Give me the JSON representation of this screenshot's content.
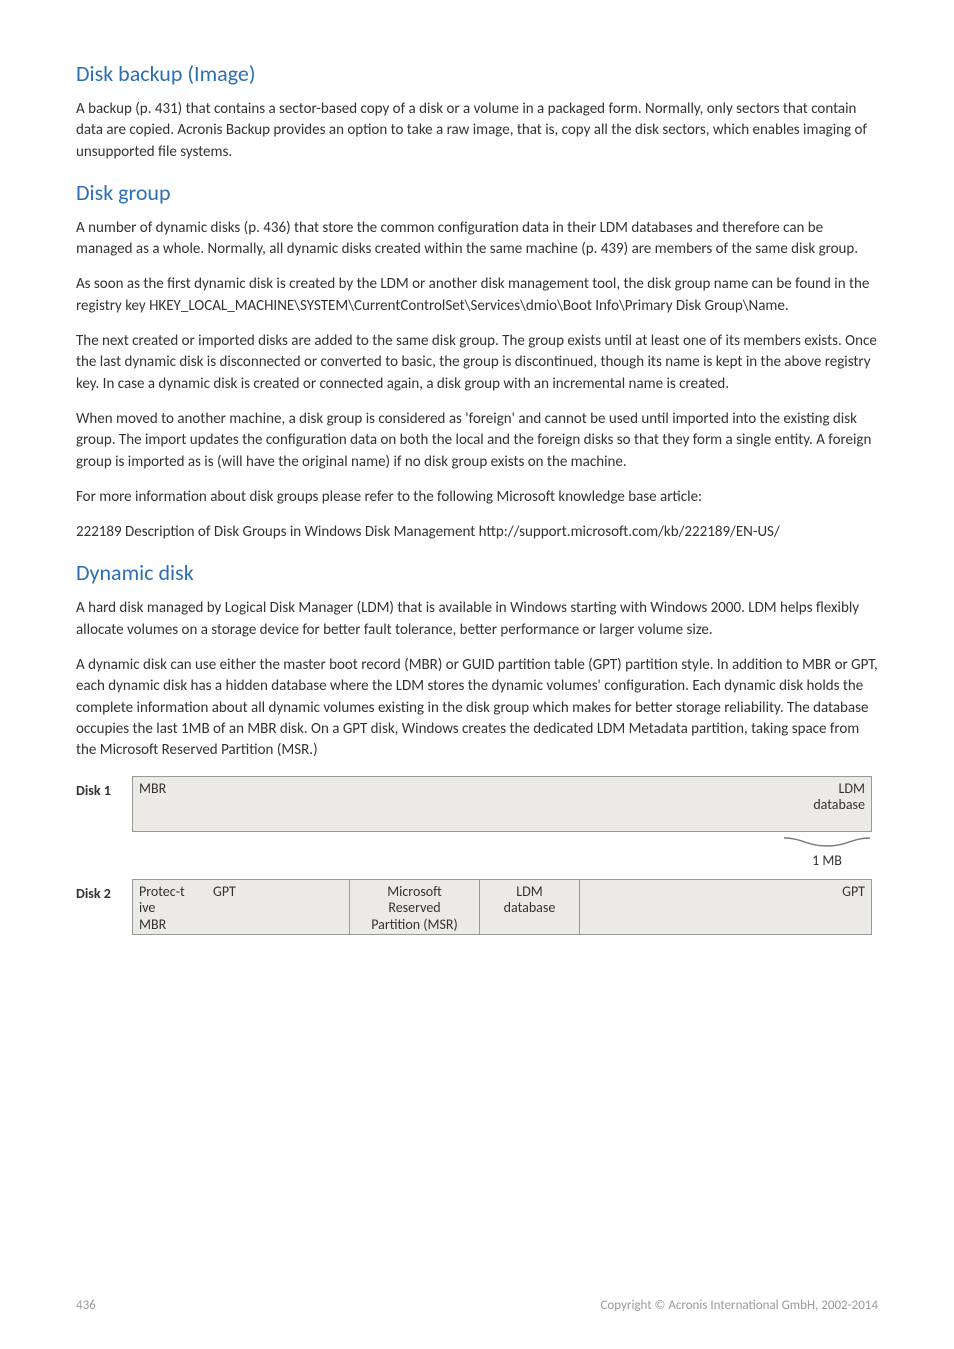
{
  "sections": {
    "disk_backup": {
      "title": "Disk backup (Image)",
      "p1": "A backup (p. 431) that contains a sector-based copy of a disk or a volume in a packaged form. Normally, only sectors that contain data are copied. Acronis Backup provides an option to take a raw image, that is, copy all the disk sectors, which enables imaging of unsupported file systems."
    },
    "disk_group": {
      "title": "Disk group",
      "p1": "A number of dynamic disks (p. 436) that store the common configuration data in their LDM databases and therefore can be managed as a whole. Normally, all dynamic disks created within the same machine (p. 439) are members of the same disk group.",
      "p2": "As soon as the first dynamic disk is created by the LDM or another disk management tool, the disk group name can be found in the registry key HKEY_LOCAL_MACHINE\\SYSTEM\\CurrentControlSet\\Services\\dmio\\Boot Info\\Primary Disk Group\\Name.",
      "p3": "The next created or imported disks are added to the same disk group. The group exists until at least one of its members exists. Once the last dynamic disk is disconnected or converted to basic, the group is discontinued, though its name is kept in the above registry key. In case a dynamic disk is created or connected again, a disk group with an incremental name is created.",
      "p4": "When moved to another machine, a disk group is considered as 'foreign' and cannot be used until imported into the existing disk group. The import updates the configuration data on both the local and the foreign disks so that they form a single entity. A foreign group is imported as is (will have the original name) if no disk group exists on the machine.",
      "p5": "For more information about disk groups please refer to the following Microsoft knowledge base article:",
      "p6": "222189 Description of Disk Groups in Windows Disk Management http://support.microsoft.com/kb/222189/EN-US/"
    },
    "dynamic_disk": {
      "title": "Dynamic disk",
      "p1": "A hard disk managed by Logical Disk Manager (LDM) that is available in Windows starting with Windows 2000. LDM helps flexibly allocate volumes on a storage device for better fault tolerance, better performance or larger volume size.",
      "p2": "A dynamic disk can use either the master boot record (MBR) or GUID partition table (GPT) partition style. In addition to MBR or GPT, each dynamic disk has a hidden database where the LDM stores the dynamic volumes' configuration. Each dynamic disk holds the complete information about all dynamic volumes existing in the disk group which makes for better storage reliability. The database occupies the last 1MB of an MBR disk. On a GPT disk, Windows creates the dedicated LDM Metadata partition, taking space from the Microsoft Reserved Partition (MSR.)"
    }
  },
  "diagram": {
    "disk1": {
      "label": "Disk 1",
      "mbr": "MBR",
      "ldm": "LDM database",
      "size": "1 MB"
    },
    "disk2": {
      "label": "Disk 2",
      "protective_line1": "Protec-t",
      "protective_line2": "ive",
      "protective_line3": "MBR",
      "gpt_left": "GPT",
      "msr_line1": "Microsoft",
      "msr_line2": "Reserved",
      "msr_line3": "Partition (MSR)",
      "ldm_line1": "LDM",
      "ldm_line2": "database",
      "gpt_right": "GPT"
    }
  },
  "footer": {
    "page": "436",
    "copyright": "Copyright © Acronis International GmbH, 2002-2014"
  }
}
